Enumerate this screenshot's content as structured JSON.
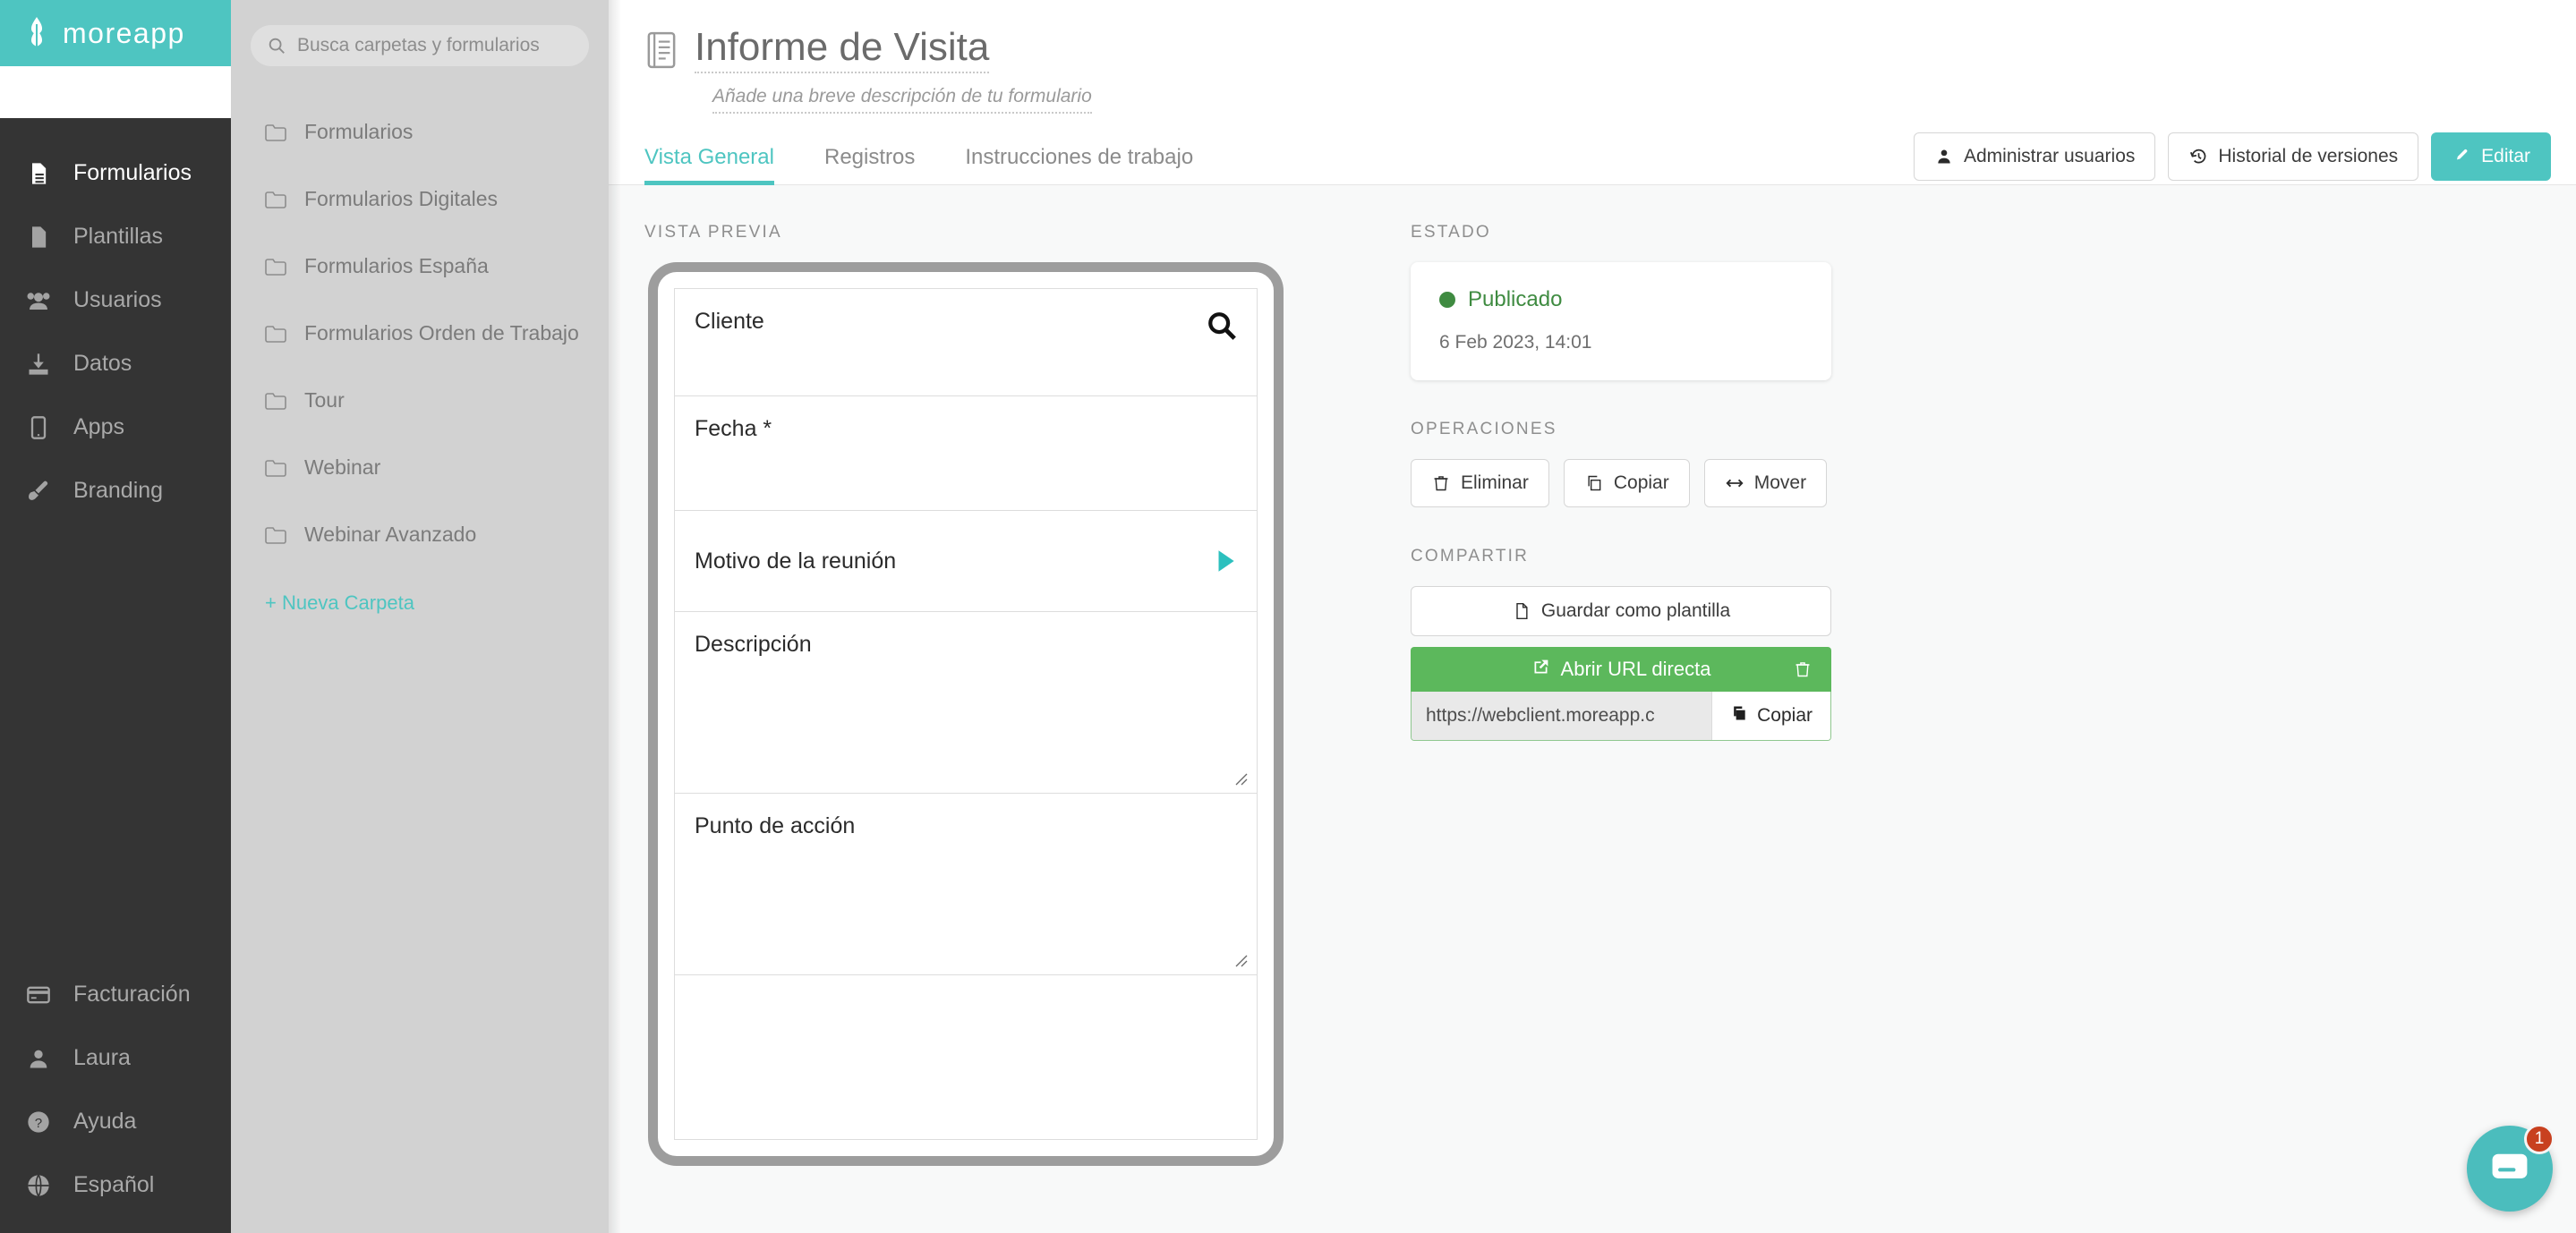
{
  "brand": {
    "name": "moreapp",
    "accent": "#4ec5c1",
    "rail_bg": "#343434",
    "folder_bg": "#d2d2d2"
  },
  "rail": {
    "items": [
      {
        "label": "Formularios",
        "icon": "document-lines-icon",
        "active": true
      },
      {
        "label": "Plantillas",
        "icon": "document-icon",
        "active": false
      },
      {
        "label": "Usuarios",
        "icon": "users-icon",
        "active": false
      },
      {
        "label": "Datos",
        "icon": "download-icon",
        "active": false
      },
      {
        "label": "Apps",
        "icon": "tablet-icon",
        "active": false
      },
      {
        "label": "Branding",
        "icon": "brush-icon",
        "active": false
      }
    ],
    "bottom_items": [
      {
        "label": "Facturación",
        "icon": "credit-card-icon"
      },
      {
        "label": "Laura",
        "icon": "user-icon"
      },
      {
        "label": "Ayuda",
        "icon": "question-circle-icon"
      },
      {
        "label": "Español",
        "icon": "globe-icon"
      }
    ]
  },
  "folders": {
    "search_placeholder": "Busca carpetas y formularios",
    "search_value": "",
    "items": [
      "Formularios",
      "Formularios Digitales",
      "Formularios España",
      "Formularios Orden de Trabajo",
      "Tour",
      "Webinar",
      "Webinar Avanzado"
    ],
    "new_folder_label": "+ Nueva Carpeta"
  },
  "header": {
    "title": "Informe de Visita",
    "description_placeholder": "Añade una breve descripción de tu formulario",
    "tabs": [
      {
        "label": "Vista General",
        "active": true
      },
      {
        "label": "Registros",
        "active": false
      },
      {
        "label": "Instrucciones de trabajo",
        "active": false
      }
    ],
    "actions": [
      {
        "label": "Administrar usuarios",
        "icon": "user-icon",
        "style": "default"
      },
      {
        "label": "Historial de versiones",
        "icon": "history-icon",
        "style": "default"
      },
      {
        "label": "Editar",
        "icon": "pencil-icon",
        "style": "primary"
      }
    ]
  },
  "preview": {
    "section_label": "Vista Previa",
    "fields": [
      {
        "label": "Cliente",
        "type": "search",
        "icon": "magnifier-icon"
      },
      {
        "label": "Fecha *",
        "type": "text",
        "icon": ""
      },
      {
        "label": "Motivo de la reunión",
        "type": "select",
        "icon": "play-triangle-icon"
      },
      {
        "label": "Descripción",
        "type": "textarea",
        "icon": "resize-grip-icon"
      },
      {
        "label": "Punto de acción",
        "type": "textarea",
        "icon": "resize-grip-icon"
      }
    ]
  },
  "status": {
    "section_label": "Estado",
    "state": "Publicado",
    "state_color": "#3f8b41",
    "timestamp": "6 Feb 2023, 14:01"
  },
  "operations": {
    "section_label": "Operaciones",
    "buttons": [
      {
        "label": "Eliminar",
        "icon": "trash-icon"
      },
      {
        "label": "Copiar",
        "icon": "copy-icon"
      },
      {
        "label": "Mover",
        "icon": "arrows-horizontal-icon"
      }
    ]
  },
  "share": {
    "section_label": "Compartir",
    "save_template_label": "Guardar como plantilla",
    "save_template_icon": "file-icon",
    "direct_url_label": "Abrir URL directa",
    "direct_url_icon": "external-link-icon",
    "delete_url_icon": "trash-icon",
    "url_value": "https://webclient.moreapp.c",
    "copy_label": "Copiar",
    "copy_icon": "copy-icon",
    "url_bar_color": "#5cb85c"
  },
  "chat": {
    "icon": "chat-bubble-icon",
    "badge": "1",
    "badge_color": "#c8401f",
    "fab_color": "#4bbdbd"
  }
}
